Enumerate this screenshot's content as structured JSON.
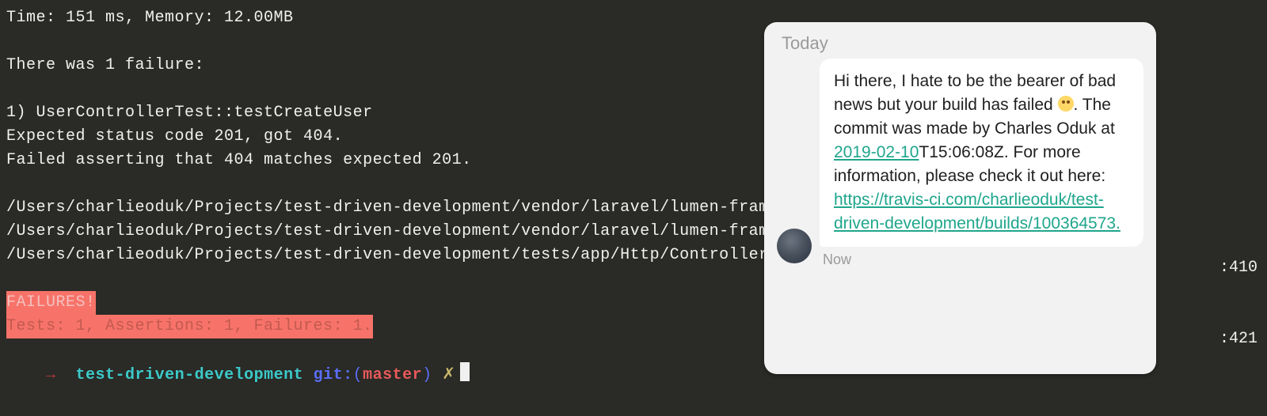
{
  "terminal": {
    "timeMemory": "Time: 151 ms, Memory: 12.00MB",
    "failureHeader": "There was 1 failure:",
    "testName": "1) UserControllerTest::testCreateUser",
    "expectedLine": "Expected status code 201, got 404.",
    "assertLine": "Failed asserting that 404 matches expected 201.",
    "trace1": "/Users/charlieoduk/Projects/test-driven-development/vendor/laravel/lumen-framework/",
    "trace2": "/Users/charlieoduk/Projects/test-driven-development/vendor/laravel/lumen-framework/",
    "trace3": "/Users/charlieoduk/Projects/test-driven-development/tests/app/Http/Controllers/Use",
    "failuresBanner": "FAILURES!",
    "failuresStats": "Tests: 1, Assertions: 1, Failures: 1.",
    "rightNum1": ":410",
    "rightNum2": ":421",
    "prompt": {
      "arrow": "→",
      "dir": "test-driven-development",
      "git": "git:",
      "parenL": "(",
      "branch": "master",
      "parenR": ")",
      "x": "✗"
    }
  },
  "chat": {
    "header": "Today",
    "msgPart1": "Hi there, I hate to be the bearer of bad news but your build has failed ",
    "msgPart2": ". The commit was made by Charles Oduk at ",
    "dateLink": "2019-02-10",
    "msgPart3": "T15:06:08Z. For more information, please check it out here: ",
    "urlLink": "https://travis-ci.com/charlieoduk/test-driven-development/builds/100364573.",
    "timestamp": "Now"
  }
}
